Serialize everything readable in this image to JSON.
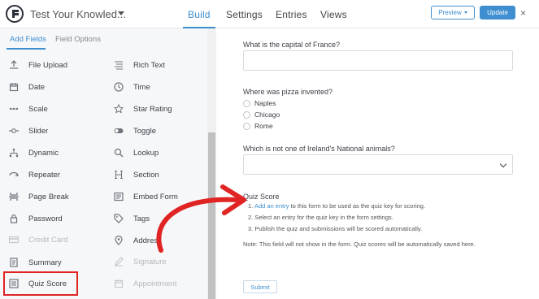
{
  "header": {
    "form_title": "Test Your Knowled...",
    "tabs": [
      "Build",
      "Settings",
      "Entries",
      "Views"
    ],
    "active_tab": "Build",
    "preview_label": "Preview",
    "update_label": "Update",
    "close_symbol": "×"
  },
  "sidebar": {
    "tabs": [
      "Add Fields",
      "Field Options"
    ],
    "active_tab": "Add Fields",
    "fields_left": [
      {
        "label": "File Upload",
        "icon": "upload-icon",
        "disabled": false
      },
      {
        "label": "Date",
        "icon": "calendar-icon",
        "disabled": false
      },
      {
        "label": "Scale",
        "icon": "scale-icon",
        "disabled": false
      },
      {
        "label": "Slider",
        "icon": "slider-icon",
        "disabled": false
      },
      {
        "label": "Dynamic",
        "icon": "dynamic-icon",
        "disabled": false
      },
      {
        "label": "Repeater",
        "icon": "repeater-icon",
        "disabled": false
      },
      {
        "label": "Page Break",
        "icon": "page-break-icon",
        "disabled": false
      },
      {
        "label": "Password",
        "icon": "lock-icon",
        "disabled": false
      },
      {
        "label": "Credit Card",
        "icon": "credit-card-icon",
        "disabled": true
      },
      {
        "label": "Summary",
        "icon": "summary-icon",
        "disabled": false
      },
      {
        "label": "Quiz Score",
        "icon": "quiz-score-icon",
        "disabled": false
      }
    ],
    "fields_right": [
      {
        "label": "Rich Text",
        "icon": "rich-text-icon",
        "disabled": false
      },
      {
        "label": "Time",
        "icon": "clock-icon",
        "disabled": false
      },
      {
        "label": "Star Rating",
        "icon": "star-icon",
        "disabled": false
      },
      {
        "label": "Toggle",
        "icon": "toggle-icon",
        "disabled": false
      },
      {
        "label": "Lookup",
        "icon": "search-icon",
        "disabled": false
      },
      {
        "label": "Section",
        "icon": "heading-icon",
        "disabled": false
      },
      {
        "label": "Embed Form",
        "icon": "embed-form-icon",
        "disabled": false
      },
      {
        "label": "Tags",
        "icon": "tag-icon",
        "disabled": false
      },
      {
        "label": "Address",
        "icon": "map-pin-icon",
        "disabled": false
      },
      {
        "label": "Signature",
        "icon": "pen-icon",
        "disabled": true
      },
      {
        "label": "Appointment",
        "icon": "appointment-icon",
        "disabled": true
      }
    ],
    "highlighted_field": "Quiz Score"
  },
  "form": {
    "q1_label": "What is the capital of France?",
    "q1_value": "",
    "q2_label": "Where was pizza invented?",
    "q2_options": [
      "Naples",
      "Chicago",
      "Rome"
    ],
    "q3_label": "Which is not one of Ireland's National animals?",
    "q3_value": "",
    "quiz_score_title": "Quiz Score",
    "quiz_step1_link": "Add an entry",
    "quiz_step1_rest": " to this form to be used as the quiz key for scoring.",
    "quiz_step2": "Select an entry for the quiz key in the form settings.",
    "quiz_step3": "Publish the quiz and submissions will be scored automatically.",
    "quiz_note": "Note: This field will not show in the form. Quiz scores will be automatically saved here.",
    "submit_label": "Submit"
  },
  "colors": {
    "accent": "#3e8ed0",
    "highlight": "#e02424",
    "arrow": "#e02424"
  }
}
